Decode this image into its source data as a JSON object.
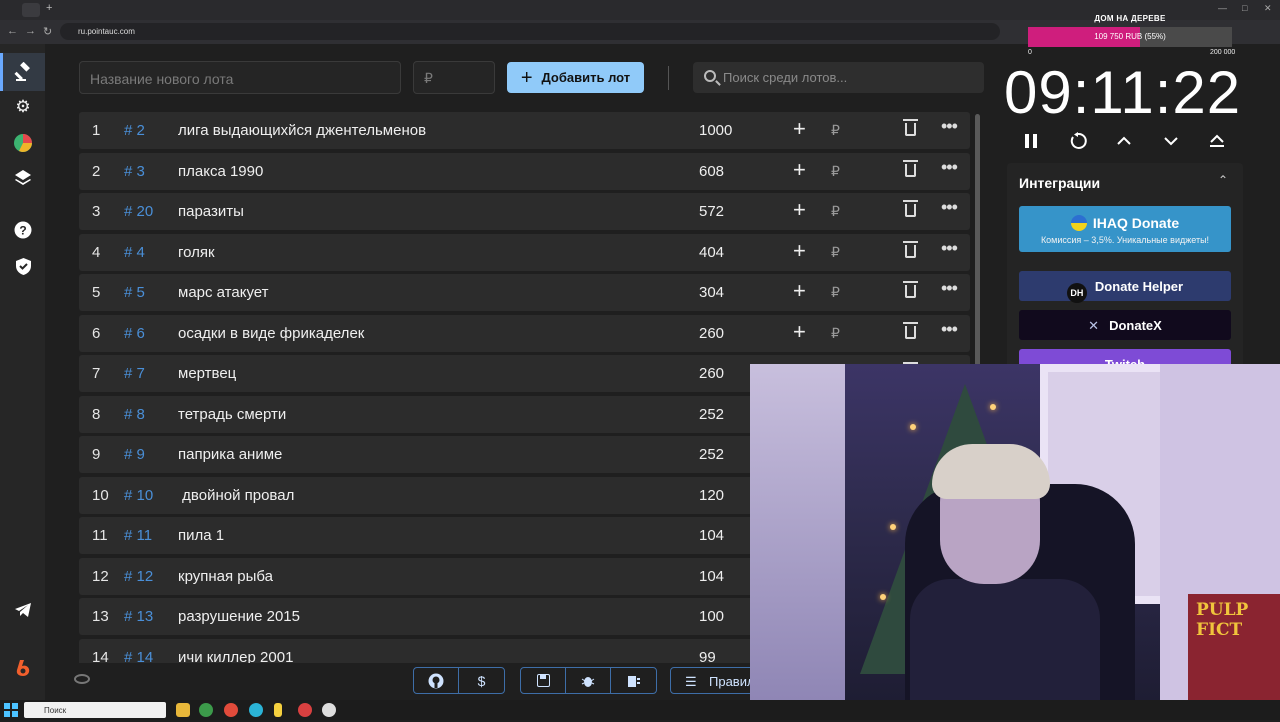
{
  "browser": {
    "url": "ru.pointauc.com"
  },
  "sidebar": {
    "items": [
      {
        "icon": "gavel-icon"
      },
      {
        "icon": "gear-icon"
      },
      {
        "icon": "pie-chart-icon"
      },
      {
        "icon": "layers-icon"
      },
      {
        "icon": "help-icon"
      },
      {
        "icon": "shield-icon"
      },
      {
        "icon": "telegram-icon"
      },
      {
        "icon": "boosty-icon"
      }
    ]
  },
  "toolbar": {
    "lot_placeholder": "Название нового лота",
    "price_placeholder": "₽",
    "add_label": "Добавить лот",
    "search_placeholder": "Поиск среди лотов..."
  },
  "lots": [
    {
      "num": "1",
      "id": "# 2",
      "name": "лига выдающихйся джентельменов",
      "amount": "1000"
    },
    {
      "num": "2",
      "id": "# 3",
      "name": "плакса 1990",
      "amount": "608"
    },
    {
      "num": "3",
      "id": "# 20",
      "name": "паразиты",
      "amount": "572"
    },
    {
      "num": "4",
      "id": "# 4",
      "name": "голяк",
      "amount": "404"
    },
    {
      "num": "5",
      "id": "# 5",
      "name": "марс атакует",
      "amount": "304"
    },
    {
      "num": "6",
      "id": "# 6",
      "name": "осадки в виде фрикаделек",
      "amount": "260"
    },
    {
      "num": "7",
      "id": "# 7",
      "name": "мертвец",
      "amount": "260"
    },
    {
      "num": "8",
      "id": "# 8",
      "name": "тетрадь смерти",
      "amount": "252"
    },
    {
      "num": "9",
      "id": "# 9",
      "name": "паприка аниме",
      "amount": "252"
    },
    {
      "num": "10",
      "id": "# 10",
      "name": " двойной провал",
      "amount": "120"
    },
    {
      "num": "11",
      "id": "# 11",
      "name": "пила 1",
      "amount": "104"
    },
    {
      "num": "12",
      "id": "# 12",
      "name": "крупная рыба",
      "amount": "104"
    },
    {
      "num": "13",
      "id": "# 13",
      "name": "разрушение 2015",
      "amount": "100"
    },
    {
      "num": "14",
      "id": "# 14",
      "name": "ичи киллер 2001",
      "amount": "99"
    }
  ],
  "row_actions": {
    "currency": "₽"
  },
  "bottom": {
    "rules_label": "Правил"
  },
  "goal": {
    "title": "ДОМ НА ДЕРЕВЕ",
    "progress_text": "109 750 RUB (55%)",
    "progress_fraction": 0.55,
    "min": "0",
    "max": "200 000",
    "fill_color": "#cf1e7d"
  },
  "timer": {
    "value": "09:11:22"
  },
  "integrations": {
    "title": "Интеграции",
    "ihaq_name": "IHAQ Donate",
    "ihaq_sub": "Комиссия – 3,5%. Уникальные виджеты!",
    "dh_logo": "DH",
    "dh_name": "Donate Helper",
    "dx_name": "DonateX",
    "twitch_name": "Twitch"
  },
  "webcam": {
    "poster_text": "PULP FICT"
  },
  "taskbar": {
    "search_placeholder": "Поиск"
  },
  "colors": {
    "accent": "#90caf9",
    "lot_id": "#4a8fd8",
    "ihaq": "#3694c9",
    "donate_helper": "#2d3b6e",
    "twitch": "#7e4bd6"
  }
}
